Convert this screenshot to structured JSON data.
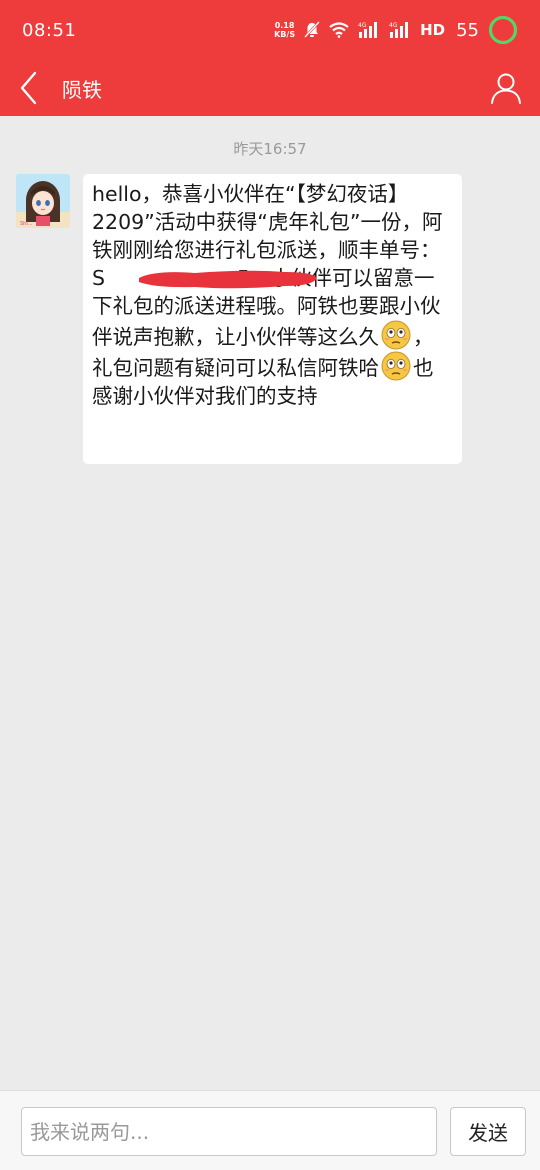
{
  "status_bar": {
    "time": "08:51",
    "net_speed_value": "0.18",
    "net_speed_unit": "KB/S",
    "hd_label": "HD",
    "battery_level": "55",
    "icons": [
      "mute-bell-icon",
      "wifi-icon",
      "4g-signal-icon",
      "4g-signal-icon",
      "hd-icon",
      "battery-ring-icon"
    ]
  },
  "navbar": {
    "title": "陨铁",
    "back_icon": "chevron-left-icon",
    "profile_icon": "person-icon"
  },
  "chat": {
    "timestamp": "昨天16:57",
    "message": {
      "sender_avatar": "anime-girl-avatar",
      "part1": "hello，恭喜小伙伴在“【梦幻夜话】2209”活动中获得“虎年礼包”一份，阿铁刚刚给您进行礼包派送，顺丰单号：S",
      "tracking_tail": "5",
      "part2": "，小伙伴可以留意一下礼包的派送进程哦。阿铁也要跟小伙伴说声抱歉，让小伙伴等这么久",
      "part3": "，礼包问题有疑问可以私信阿铁哈",
      "part4": "也感谢小伙伴对我们的支持",
      "emoji": "flushed-face-emoji"
    }
  },
  "composer": {
    "placeholder": "我来说两句...",
    "value": "",
    "send_label": "发送"
  },
  "colors": {
    "header": "#ee3b3b",
    "background": "#ebebeb",
    "bubble": "#ffffff",
    "redaction": "#e8323c"
  }
}
